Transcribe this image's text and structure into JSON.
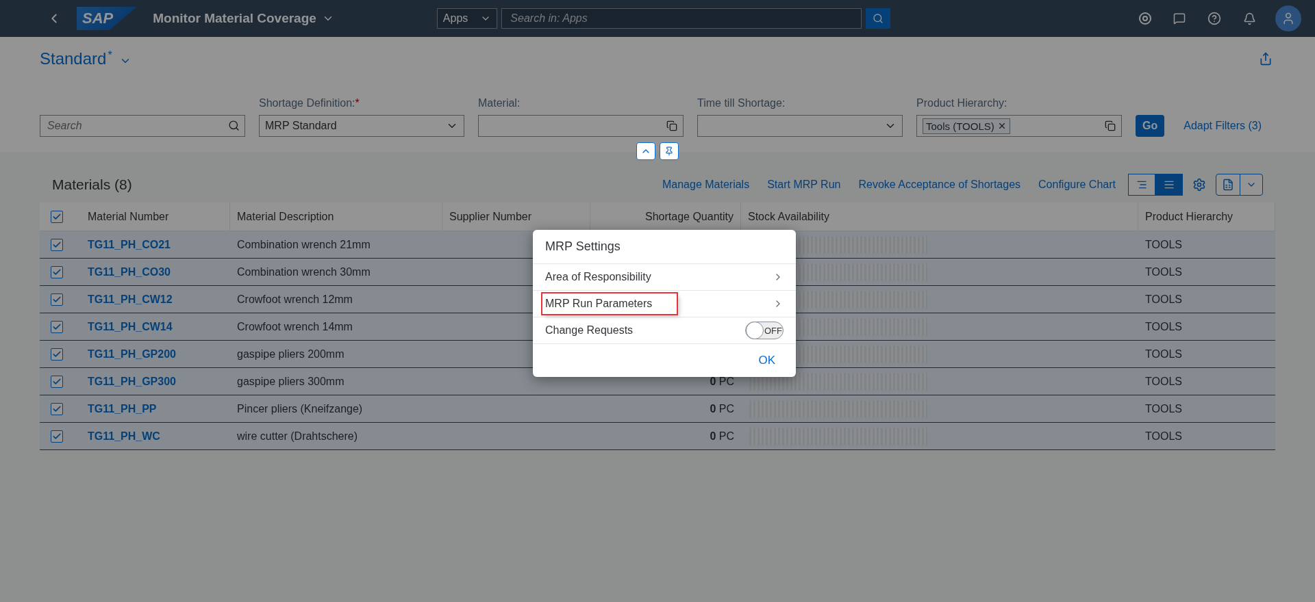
{
  "shell": {
    "logo": "SAP",
    "title": "Monitor Material Coverage",
    "scope": "Apps",
    "search_placeholder": "Search in: Apps"
  },
  "variant": {
    "name": "Standard",
    "modified_mark": "*"
  },
  "filters": {
    "search_placeholder": "Search",
    "fields": [
      {
        "kind": "select",
        "label": "Shortage Definition:",
        "required": true,
        "value": "MRP Standard"
      },
      {
        "kind": "valuehelp",
        "label": "Material:",
        "required": false
      },
      {
        "kind": "select",
        "label": "Time till Shortage:",
        "required": false
      },
      {
        "kind": "tokens",
        "label": "Product Hierarchy:",
        "required": false,
        "tokens": [
          "Tools (TOOLS)"
        ]
      }
    ],
    "go": "Go",
    "adapt": "Adapt Filters (3)"
  },
  "table": {
    "title": "Materials (8)",
    "actions": [
      "Manage Materials",
      "Start MRP Run",
      "Revoke Acceptance of Shortages",
      "Configure Chart"
    ],
    "view_modes": [
      {
        "selected": false
      },
      {
        "selected": true
      }
    ],
    "select_all_checked": true,
    "columns": [
      "Material Number",
      "Material Description",
      "Supplier Number",
      "Shortage Quantity",
      "Stock Availability",
      "Product Hierarchy"
    ],
    "rows": [
      {
        "selected": true,
        "material": "TG11_PH_CO21",
        "description": "Combination wrench 21mm",
        "hierarchy": "TOOLS"
      },
      {
        "selected": true,
        "material": "TG11_PH_CO30",
        "description": "Combination wrench 30mm",
        "hierarchy": "TOOLS"
      },
      {
        "selected": true,
        "material": "TG11_PH_CW12",
        "description": "Crowfoot wrench 12mm",
        "hierarchy": "TOOLS"
      },
      {
        "selected": true,
        "material": "TG11_PH_CW14",
        "description": "Crowfoot wrench 14mm",
        "hierarchy": "TOOLS"
      },
      {
        "selected": true,
        "material": "TG11_PH_GP200",
        "description": "gaspipe pliers 200mm",
        "hierarchy": "TOOLS"
      },
      {
        "selected": true,
        "material": "TG11_PH_GP300",
        "description": "gaspipe pliers 300mm",
        "shortage": "**0** PC",
        "hierarchy": "TOOLS"
      },
      {
        "selected": true,
        "material": "TG11_PH_PP",
        "description": "Pincer pliers (Kneifzange)",
        "shortage": "**0** PC",
        "hierarchy": "TOOLS"
      },
      {
        "selected": true,
        "material": "TG11_PH_WC",
        "description": "wire cutter (Drahtschere)",
        "shortage": "**0** PC",
        "hierarchy": "TOOLS"
      }
    ]
  },
  "dialog": {
    "title": "MRP Settings",
    "items": [
      {
        "kind": "navigation",
        "label": "Area of Responsibility",
        "highlighted": false
      },
      {
        "kind": "navigation",
        "label": "MRP Run Parameters",
        "highlighted": true
      },
      {
        "kind": "switch",
        "label": "Change Requests",
        "on": false,
        "state_label": "OFF",
        "highlighted": false
      }
    ],
    "ok": "OK"
  }
}
